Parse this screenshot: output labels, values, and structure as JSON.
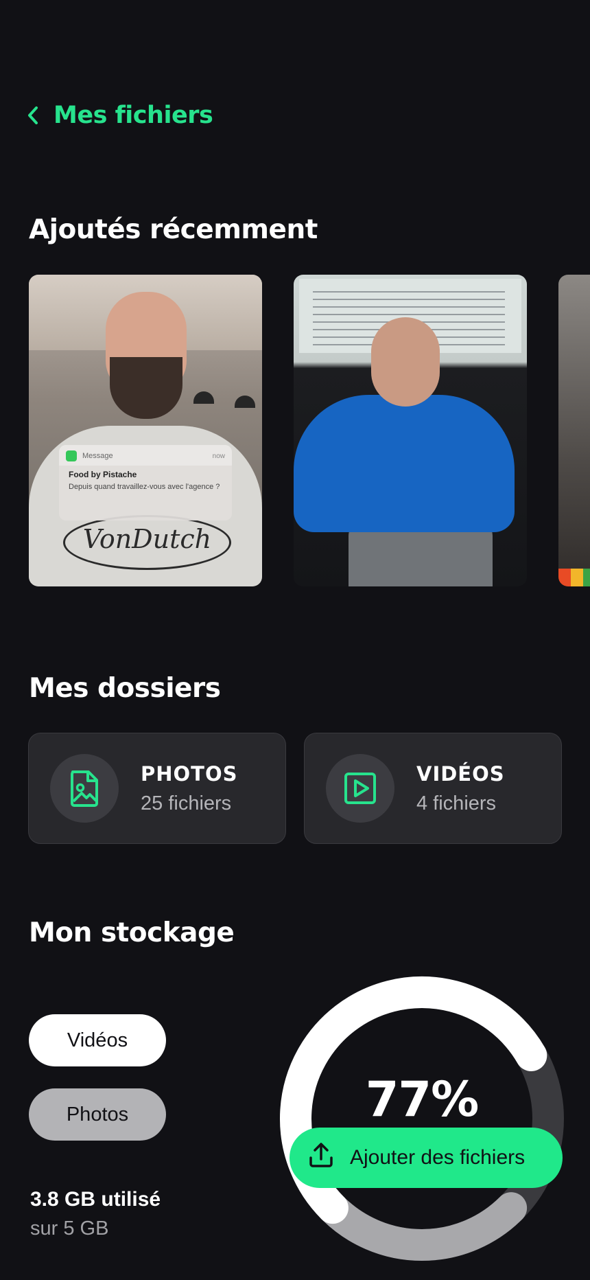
{
  "header": {
    "back_label": "Mes fichiers"
  },
  "recent": {
    "title": "Ajoutés récemment",
    "notification": {
      "app": "Message",
      "time": "now",
      "sender": "Food by Pistache",
      "text": "Depuis quand travaillez-vous avec l'agence ?"
    },
    "shirt_logo": "VonDutch"
  },
  "folders": {
    "title": "Mes dossiers",
    "items": [
      {
        "name": "PHOTOS",
        "count": "25 fichiers",
        "icon": "image-file-icon"
      },
      {
        "name": "VIDÉOS",
        "count": "4 fichiers",
        "icon": "video-file-icon"
      }
    ]
  },
  "storage": {
    "title": "Mon stockage",
    "filters": [
      "Vidéos",
      "Photos"
    ],
    "used_label": "3.8 GB utilisé",
    "total_label": "sur 5 GB",
    "percent_label": "77%",
    "percent_value": 77,
    "add_button": "Ajouter des fichiers"
  },
  "colors": {
    "accent": "#27e38d",
    "background": "#111115",
    "card": "#28282c"
  }
}
